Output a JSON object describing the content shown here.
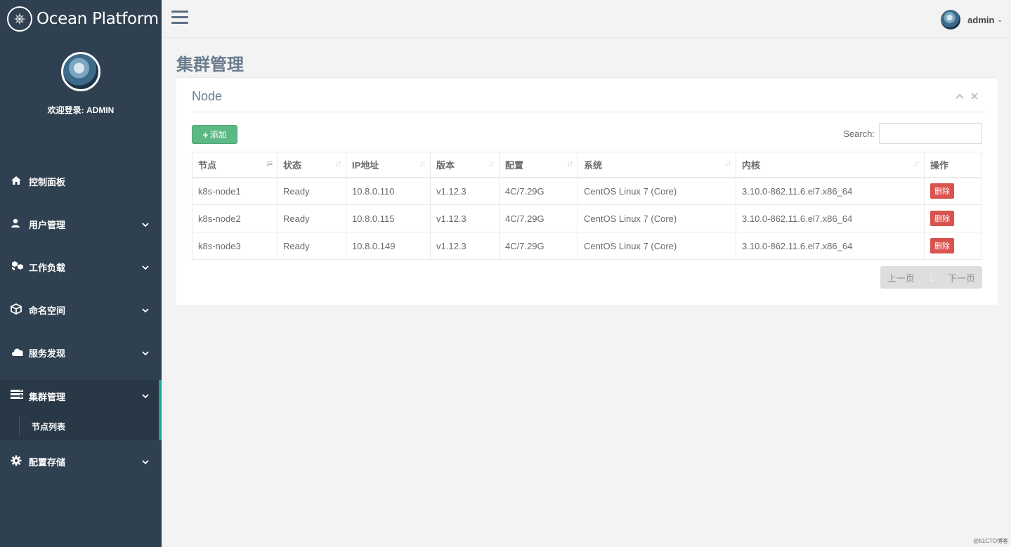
{
  "brand": {
    "name": "Ocean Platform",
    "logo_icon": "helm-icon"
  },
  "profile": {
    "welcome": "欢迎登录: ADMIN"
  },
  "nav": {
    "items": [
      {
        "label": "控制面板",
        "icon": "home-icon"
      },
      {
        "label": "用户管理",
        "icon": "user-icon"
      },
      {
        "label": "工作负载",
        "icon": "cubes-icon"
      },
      {
        "label": "命名空间",
        "icon": "cube-icon"
      },
      {
        "label": "服务发现",
        "icon": "cloud-icon"
      },
      {
        "label": "集群管理",
        "icon": "server-icon",
        "active": true
      },
      {
        "label": "配置存储",
        "icon": "gear-icon"
      }
    ],
    "sub_items": [
      {
        "label": "节点列表"
      }
    ]
  },
  "topbar": {
    "username": "admin"
  },
  "page": {
    "title": "集群管理"
  },
  "panel": {
    "title": "Node",
    "add_label": "添加",
    "search_label": "Search:",
    "search_value": ""
  },
  "table": {
    "headers": [
      "节点",
      "状态",
      "IP地址",
      "版本",
      "配置",
      "系统",
      "内核",
      "操作"
    ],
    "rows": [
      {
        "node": "k8s-node1",
        "status": "Ready",
        "ip": "10.8.0.110",
        "version": "v1.12.3",
        "config": "4C/7.29G",
        "os": "CentOS Linux 7 (Core)",
        "kernel": "3.10.0-862.11.6.el7.x86_64",
        "action": "删除"
      },
      {
        "node": "k8s-node2",
        "status": "Ready",
        "ip": "10.8.0.115",
        "version": "v1.12.3",
        "config": "4C/7.29G",
        "os": "CentOS Linux 7 (Core)",
        "kernel": "3.10.0-862.11.6.el7.x86_64",
        "action": "删除"
      },
      {
        "node": "k8s-node3",
        "status": "Ready",
        "ip": "10.8.0.149",
        "version": "v1.12.3",
        "config": "4C/7.29G",
        "os": "CentOS Linux 7 (Core)",
        "kernel": "3.10.0-862.11.6.el7.x86_64",
        "action": "删除"
      }
    ]
  },
  "pager": {
    "prev": "上一页",
    "current": "1",
    "next": "下一页"
  },
  "watermark": "@51CTO博客",
  "colors": {
    "sidebar": "#2f4050",
    "accent": "#19aa8d",
    "add_button": "#5cb885",
    "delete_button": "#d9534f"
  }
}
